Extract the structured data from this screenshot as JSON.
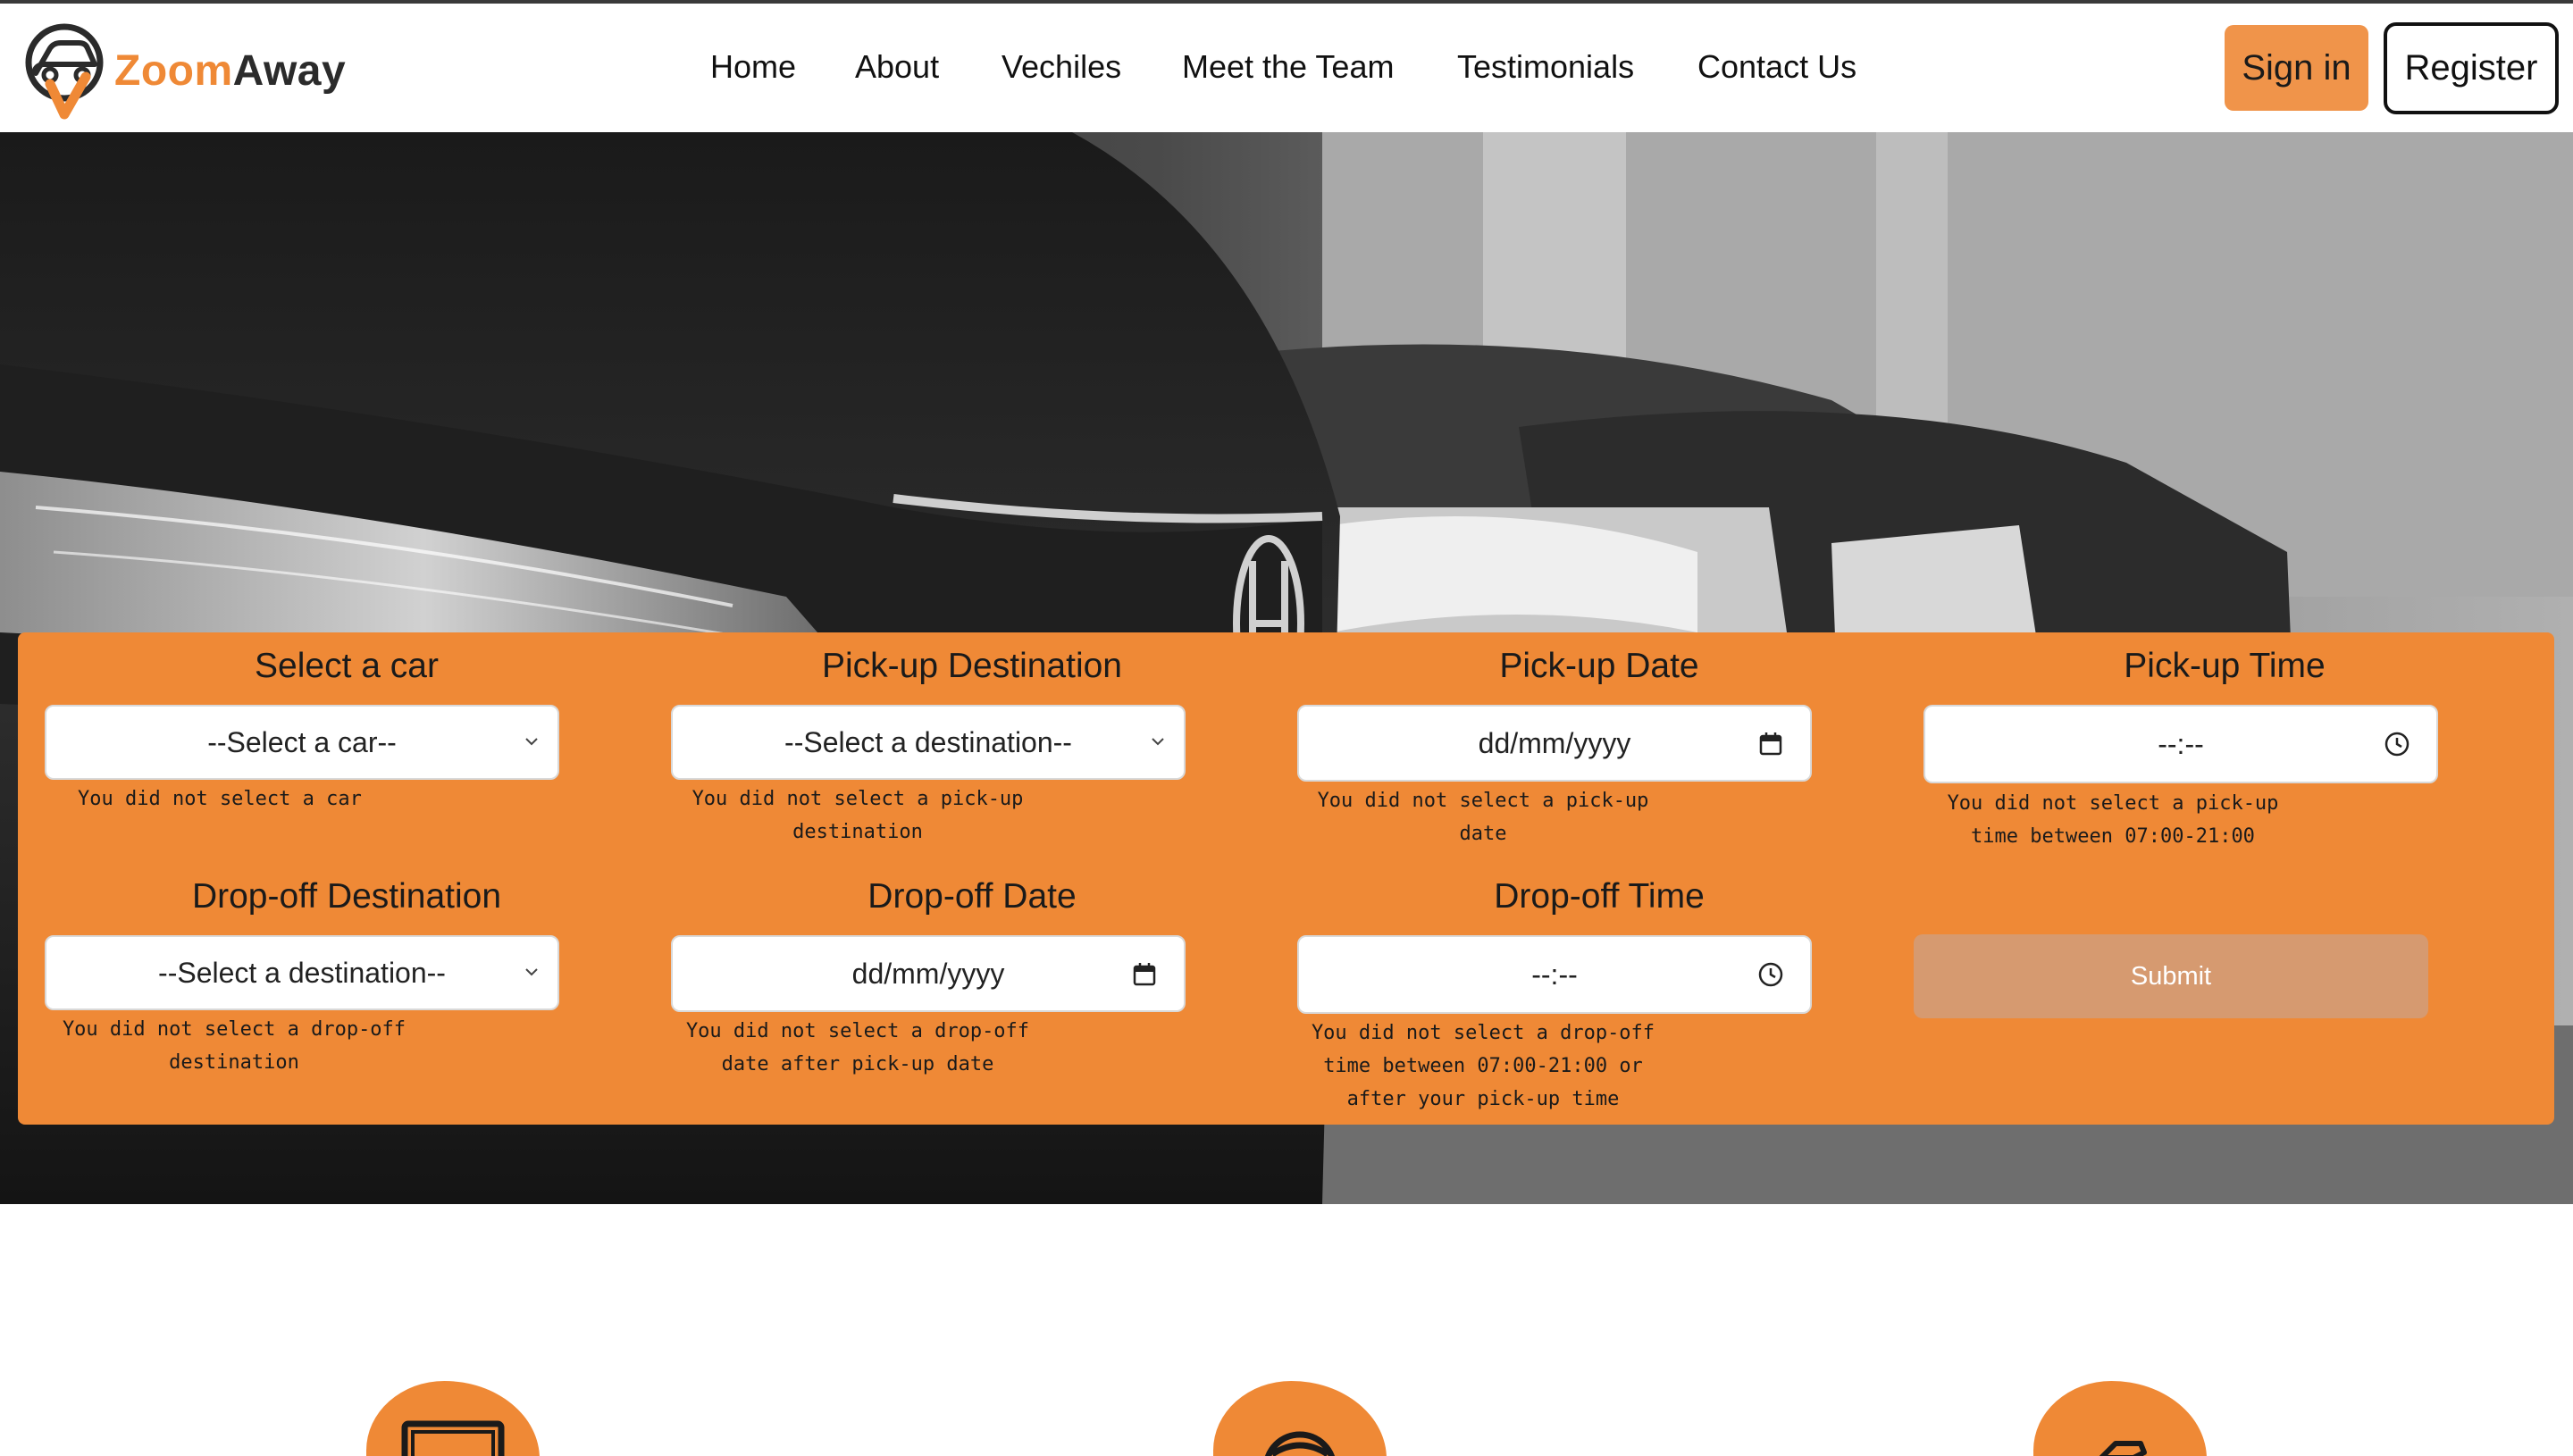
{
  "brand": {
    "name_part1": "Zoom",
    "name_part2": "Away",
    "logo_icon": "car-location-pin-icon",
    "accent_color": "#ef8936"
  },
  "nav": {
    "items": [
      {
        "label": "Home"
      },
      {
        "label": "About"
      },
      {
        "label": "Vechiles"
      },
      {
        "label": "Meet the Team"
      },
      {
        "label": "Testimonials"
      },
      {
        "label": "Contact Us"
      }
    ],
    "signin_label": "Sign in",
    "register_label": "Register"
  },
  "booking_form": {
    "car": {
      "title": "Select a car",
      "value": "--Select a car--",
      "error": "You did not select a car"
    },
    "pickup_destination": {
      "title": "Pick-up Destination",
      "value": "--Select a destination--",
      "error": "You did not select a pick-up\ndestination"
    },
    "pickup_date": {
      "title": "Pick-up Date",
      "value": "dd/mm/yyyy",
      "error": "You did not select a pick-up\ndate"
    },
    "pickup_time": {
      "title": "Pick-up Time",
      "value": "--:--",
      "error": "You did not select a pick-up\ntime between 07:00-21:00"
    },
    "dropoff_destination": {
      "title": "Drop-off Destination",
      "value": "--Select a destination--",
      "error": "You did not select a drop-off\ndestination"
    },
    "dropoff_date": {
      "title": "Drop-off Date",
      "value": "dd/mm/yyyy",
      "error": "You did not select a drop-off\ndate after pick-up date"
    },
    "dropoff_time": {
      "title": "Drop-off Time",
      "value": "--:--",
      "error": "You did not select a drop-off\ntime between 07:00-21:00 or\nafter your pick-up time"
    },
    "submit_label": "Submit",
    "panel_color": "#ef8936",
    "submit_color": "#d69a70"
  },
  "features": {
    "icons": [
      "monitor-icon",
      "steering-wheel-icon",
      "car-key-hand-icon"
    ]
  }
}
